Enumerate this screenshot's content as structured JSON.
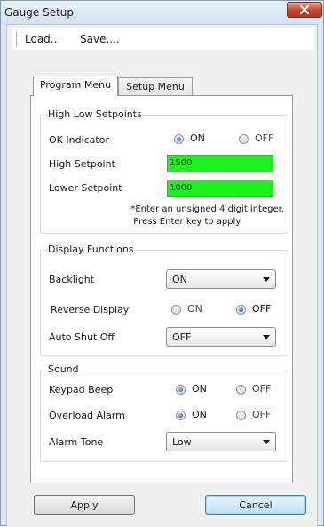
{
  "window": {
    "title": "Gauge Setup"
  },
  "menu": {
    "load": "Load...",
    "save": "Save...."
  },
  "tabs": [
    {
      "label": "Program Menu",
      "active": true
    },
    {
      "label": "Setup Menu",
      "active": false
    }
  ],
  "high_low": {
    "title": "High Low Setpoints",
    "ok_indicator": {
      "label": "OK Indicator",
      "on": "ON",
      "off": "OFF",
      "selected": "ON"
    },
    "high_setpoint": {
      "label": "High Setpoint",
      "value": "1500"
    },
    "lower_setpoint": {
      "label": "Lower Setpoint",
      "value": "1000"
    },
    "note_line1": "*Enter an unsigned 4 digit integer.",
    "note_line2": "Press Enter key to apply."
  },
  "display": {
    "title": "Display Functions",
    "backlight": {
      "label": "Backlight",
      "value": "ON"
    },
    "reverse_display": {
      "label": "Reverse Display",
      "on": "ON",
      "off": "OFF",
      "selected": "OFF"
    },
    "auto_shut_off": {
      "label": "Auto Shut Off",
      "value": "OFF"
    }
  },
  "sound": {
    "title": "Sound",
    "keypad_beep": {
      "label": "Keypad Beep",
      "on": "ON",
      "off": "OFF",
      "selected": "ON"
    },
    "overload_alarm": {
      "label": "Overload Alarm",
      "on": "ON",
      "off": "OFF",
      "selected": "ON"
    },
    "alarm_tone": {
      "label": "Alarm Tone",
      "value": "Low"
    }
  },
  "buttons": {
    "apply": "Apply",
    "cancel": "Cancel"
  },
  "colors": {
    "setpoint_field": "#1cf21c",
    "close_button": "#c6432c",
    "radio_selected": "#1f6fc5"
  },
  "icons": {
    "close": "close-x-icon",
    "dropdown": "chevron-down-icon"
  }
}
